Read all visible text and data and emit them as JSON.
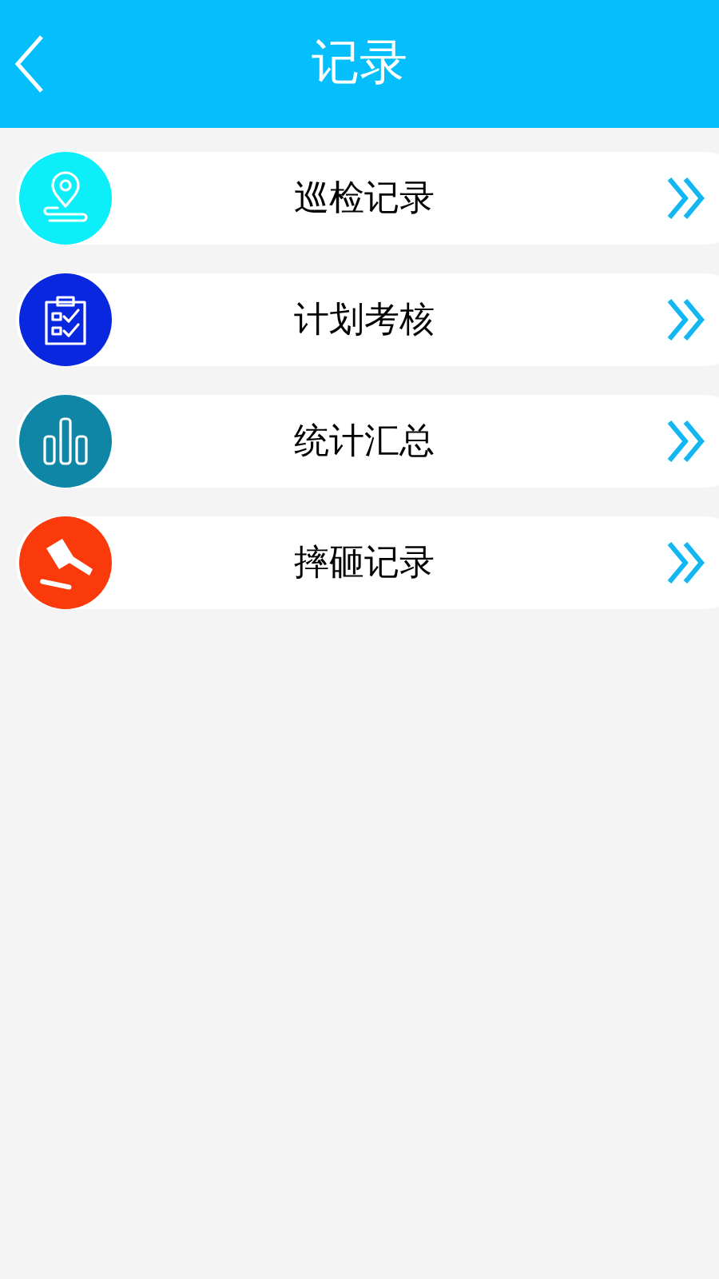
{
  "header": {
    "title": "记录"
  },
  "items": [
    {
      "label": "巡检记录",
      "kind": "location",
      "color": "#0ceef8"
    },
    {
      "label": "计划考核",
      "kind": "clipboard",
      "color": "#0a27e0"
    },
    {
      "label": "统计汇总",
      "kind": "bars",
      "color": "#0f86a6"
    },
    {
      "label": "摔砸记录",
      "kind": "hammer",
      "color": "#fb3a0c"
    }
  ]
}
